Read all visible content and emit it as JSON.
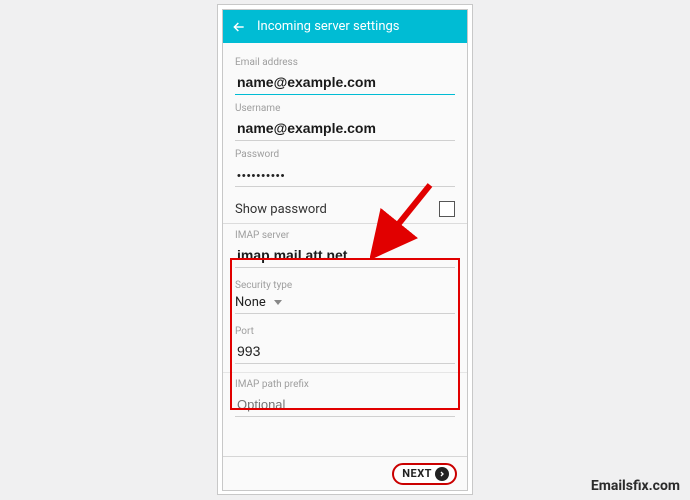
{
  "appbar": {
    "title": "Incoming server settings"
  },
  "fields": {
    "email_label": "Email address",
    "email_value": "name@example.com",
    "username_label": "Username",
    "username_value": "name@example.com",
    "password_label": "Password",
    "password_value": "••••••••••",
    "show_password_label": "Show password",
    "imap_server_label": "IMAP server",
    "imap_server_value": "imap.mail.att.net",
    "security_label": "Security type",
    "security_value": "None",
    "port_label": "Port",
    "port_value": "993",
    "prefix_label": "IMAP path prefix",
    "prefix_placeholder": "Optional"
  },
  "buttons": {
    "next": "NEXT"
  },
  "watermark": "Emailsfix.com"
}
